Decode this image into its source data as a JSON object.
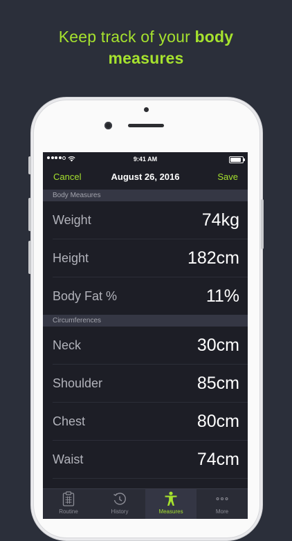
{
  "headline": {
    "part1": "Keep track of your ",
    "part2": "body",
    "part3": "measures"
  },
  "status_bar": {
    "time": "9:41 AM"
  },
  "nav": {
    "cancel_label": "Cancel",
    "title": "August 26, 2016",
    "save_label": "Save"
  },
  "sections": [
    {
      "header": "Body Measures",
      "rows": [
        {
          "label": "Weight",
          "value": "74kg"
        },
        {
          "label": "Height",
          "value": "182cm"
        },
        {
          "label": "Body Fat %",
          "value": "11%"
        }
      ]
    },
    {
      "header": "Circumferences",
      "rows": [
        {
          "label": "Neck",
          "value": "30cm"
        },
        {
          "label": "Shoulder",
          "value": "85cm"
        },
        {
          "label": "Chest",
          "value": "80cm"
        },
        {
          "label": "Waist",
          "value": "74cm"
        }
      ]
    }
  ],
  "tabs": [
    {
      "label": "Routine",
      "icon": "clipboard-icon",
      "active": false
    },
    {
      "label": "History",
      "icon": "history-clock-icon",
      "active": false
    },
    {
      "label": "Measures",
      "icon": "person-icon",
      "active": true
    },
    {
      "label": "More",
      "icon": "more-dots-icon",
      "active": false
    }
  ],
  "colors": {
    "accent": "#a6e22e",
    "background": "#2b2f3a",
    "screen": "#1d1e26",
    "section_header": "#353744"
  }
}
